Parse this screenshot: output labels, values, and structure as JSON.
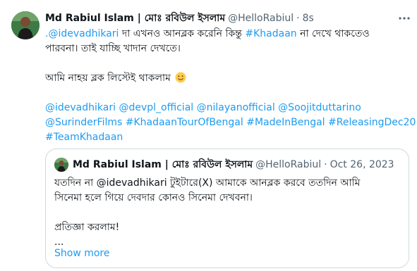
{
  "tweet": {
    "display_name": "Md Rabiul Islam | মোঃ রবিউল ইসলাম",
    "handle": "@HelloRabiul",
    "separator": "·",
    "time": "8s",
    "more_icon": "more-horizontal-icon",
    "lines": [
      {
        "mention": ".@idevadhikari",
        "t1": " দা এখনও আনব্লক করেনি কিন্তু ",
        "hashtag": "#Khadaan",
        "t2": " না দেখে থাকতেও"
      },
      "পারবনা। তাই যাচ্ছি খাদান দেখতে।",
      "আমি নাহয় ব্লক লিস্টেই থাকলাম"
    ],
    "emoji": "slightly-smiling-face",
    "tags_line1": "@idevadhikari @devpl_official @nilayanofficial @Soojitduttarino",
    "tags_line2": "@SurinderFilms #KhadaanTourOfBengal #MadeInBengal #ReleasingDec20",
    "tags_line3": "#TeamKhadaan"
  },
  "quoted": {
    "display_name": "Md Rabiul Islam | মোঃ রবিউল ইসলাম",
    "handle": "@HelloRabiul",
    "separator": "·",
    "date": "Oct 26, 2023",
    "lines": [
      "যতদিন না @idevadhikari টুইটারে(X) আমাকে আনব্লক করবে ততদিন আমি",
      "সিনেমা হলে গিয়ে দেবদার কোনও সিনেমা দেখবনা।",
      "প্রতিজ্ঞা করলাম!",
      "..."
    ],
    "show_more": "Show more"
  },
  "colors": {
    "text": "#0f1419",
    "secondary": "#536471",
    "link": "#1d9bf0",
    "border": "#cfd9de"
  }
}
